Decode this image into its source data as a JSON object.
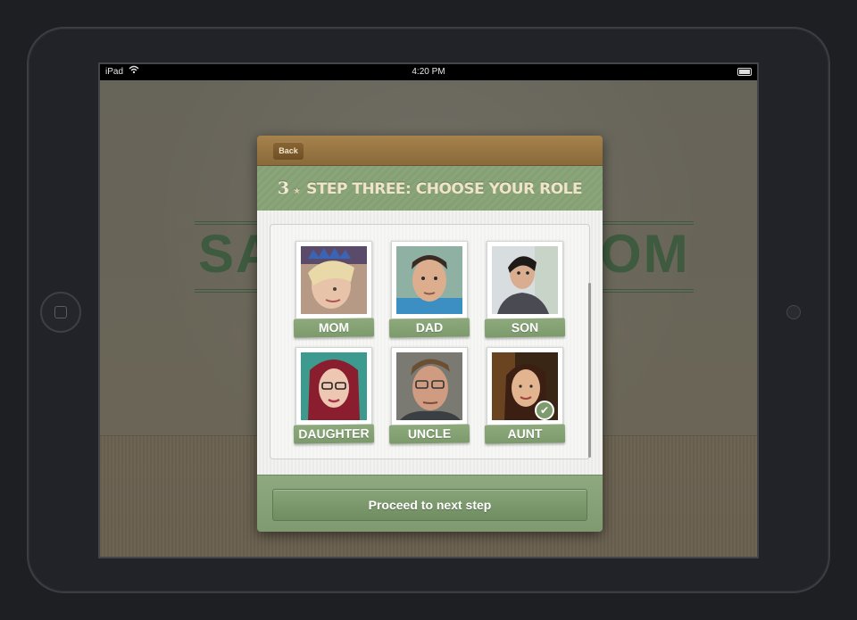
{
  "statusbar": {
    "carrier": "iPad",
    "time": "4:20 PM"
  },
  "background_logo": {
    "left_text": "SA",
    "right_text": "OM"
  },
  "modal": {
    "back_label": "Back",
    "step_number": "3",
    "step_title": "STEP THREE: CHOOSE YOUR ROLE",
    "roles": [
      {
        "label": "MOM",
        "selected": false
      },
      {
        "label": "DAD",
        "selected": false
      },
      {
        "label": "SON",
        "selected": false
      },
      {
        "label": "DAUGHTER",
        "selected": false
      },
      {
        "label": "UNCLE",
        "selected": false
      },
      {
        "label": "AUNT",
        "selected": true
      }
    ],
    "proceed_label": "Proceed to next step"
  },
  "colors": {
    "accent_green": "#7e9b6d",
    "header_brown": "#8a6a3b"
  }
}
